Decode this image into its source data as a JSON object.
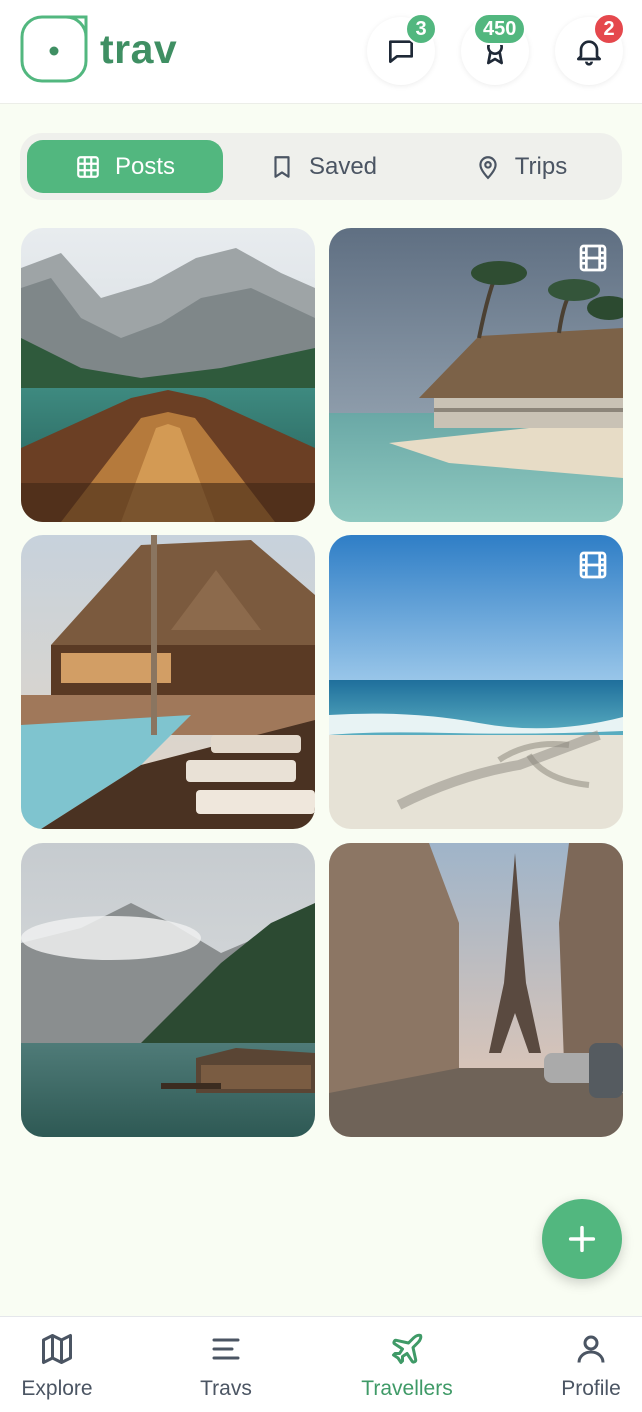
{
  "app": {
    "name": "trav"
  },
  "header": {
    "messages": {
      "icon": "chat-icon",
      "badge": "3"
    },
    "rewards": {
      "icon": "award-icon",
      "badge": "450"
    },
    "notifications": {
      "icon": "bell-icon",
      "badge": "2"
    }
  },
  "tabs": [
    {
      "label": "Posts",
      "icon": "grid-icon",
      "active": true
    },
    {
      "label": "Saved",
      "icon": "bookmark-icon",
      "active": false
    },
    {
      "label": "Trips",
      "icon": "map-pin-icon",
      "active": false
    }
  ],
  "posts": [
    {
      "scene": "mountain lake with wooden boat",
      "video": false
    },
    {
      "scene": "beach hut on tropical shore",
      "video": true
    },
    {
      "scene": "lodge with pool and sun loungers",
      "video": false
    },
    {
      "scene": "sandy beach with palm shadow",
      "video": true
    },
    {
      "scene": "misty mountains with lake cabin",
      "video": false
    },
    {
      "scene": "Eiffel tower street view",
      "video": false
    }
  ],
  "nav": [
    {
      "label": "Explore",
      "icon": "map-icon",
      "active": false
    },
    {
      "label": "Travs",
      "icon": "menu-lines-icon",
      "active": false
    },
    {
      "label": "Travellers",
      "icon": "plane-icon",
      "active": true
    },
    {
      "label": "Profile",
      "icon": "user-icon",
      "active": false
    }
  ],
  "colors": {
    "accent": "#52b77f",
    "accent_dark": "#3f8f63",
    "badge_red": "#e5484d",
    "background": "#f9fdf3"
  }
}
